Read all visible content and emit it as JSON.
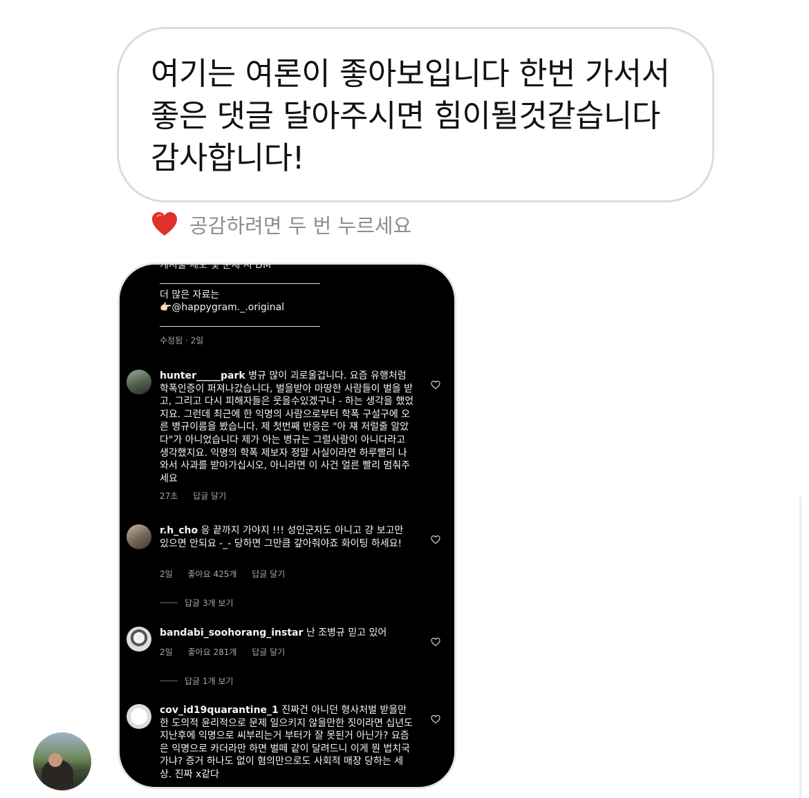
{
  "message": {
    "lines": [
      "여기는 여론이 좋아보입니다 한번 가서서",
      "좋은 댓글 달아주시면 힘이될것같습니다",
      "감사합니다!"
    ]
  },
  "reaction_hint": "공감하려면 두 번 누르세요",
  "screenshot": {
    "cut_text": "게시물 제보 및 문제 시 DM",
    "more_label": "더 많은 자료는",
    "handle": "👉🏻@happygram._.original",
    "post_meta": "수정됨 · 2일",
    "comments": [
      {
        "user": "hunter_____park",
        "text": "병규 많이 괴로울겁니다. 요즘 유행처럼 학폭인증이 퍼져나갔습니다, 벌을받아 마땅한 사람들이 벌을 받고, 그리고 다시 피해자들은 웃을수있겠구나 - 하는 생각을 했었지요. 그런데 최근에 한 익명의 사람으로부터 학폭 구설구에 오른 병규이름을 봤습니다. 제 첫번째 반응은 \"아 쟤 저럴줄 알았다\"가 아니었습니다 제가 아는 병규는 그럴사람이 아니다라고 생각했지요. 익명의 학폭 제보자 정말 사실이라면 하루빨리 나와서 사과를 받아가십시오, 아니라면 이 사건 얼른 빨리 멈춰주세요",
        "time": "27초",
        "likes": "",
        "reply": "답글 달기",
        "replies": ""
      },
      {
        "user": "r.h_cho",
        "text": "응 끝까지 가야지 !!! 성인군자도 아니고 걍 보고만 있으면 안되요 -_- 당하면 그만큼 갚아줘야죠 화이팅 하세요!",
        "time": "2일",
        "likes": "좋아요 425개",
        "reply": "답글 달기",
        "replies": "답글 3개 보기"
      },
      {
        "user": "bandabi_soohorang_instar",
        "text": "난 조병규 믿고 있어",
        "time": "2일",
        "likes": "좋아요 281개",
        "reply": "답글 달기",
        "replies": "답글 1개 보기"
      },
      {
        "user": "cov_id19quarantine_1",
        "text": "진짜건 아니던 형사처벌 받을만한 도의적 윤리적으로 문제 일으키지 않을만한 짓이라면 십년도 지난후에 익명으로 씨부리는거 부터가 잘 못된거 아닌가? 요즘은 익명으로 카더라만 하면 벌떼 같이 달려드니 이게 뭔 법치국가냐? 증거 하나도 없이 혐의만으로도 사회적 매장 당하는 세상. 진짜 x같다",
        "time": "",
        "likes": "",
        "reply": "",
        "replies": ""
      }
    ]
  },
  "colors": {
    "bubble_border": "#dcdcdc",
    "hint_text": "#8e8e8e",
    "heart": "#e0302a",
    "screenshot_bg": "#000000",
    "meta_text": "#a8a8a8"
  }
}
